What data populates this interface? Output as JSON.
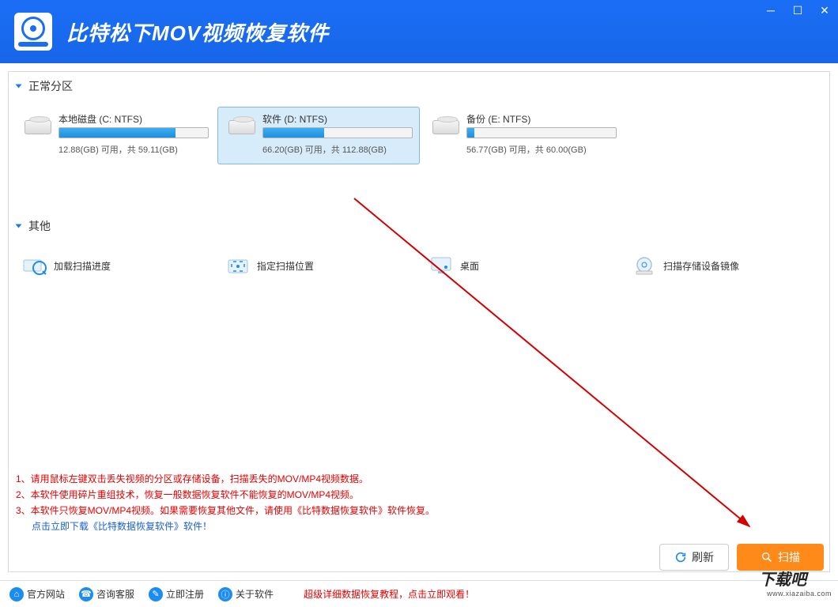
{
  "app_title": "比特松下MOV视频恢复软件",
  "sections": {
    "partitions_title": "正常分区",
    "others_title": "其他"
  },
  "partitions": [
    {
      "name": "本地磁盘 (C: NTFS)",
      "detail": "12.88(GB) 可用，共 59.11(GB)",
      "fill_pct": 78,
      "selected": false
    },
    {
      "name": "软件 (D: NTFS)",
      "detail": "66.20(GB) 可用，共 112.88(GB)",
      "fill_pct": 41,
      "selected": true
    },
    {
      "name": "备份 (E: NTFS)",
      "detail": "56.77(GB) 可用，共 60.00(GB)",
      "fill_pct": 5,
      "selected": false
    }
  ],
  "others": [
    {
      "label": "加载扫描进度",
      "icon": "load-progress-icon"
    },
    {
      "label": "指定扫描位置",
      "icon": "set-location-icon"
    },
    {
      "label": "桌面",
      "icon": "desktop-icon"
    },
    {
      "label": "扫描存储设备镜像",
      "icon": "scan-image-icon"
    }
  ],
  "tips": {
    "line1": "1、请用鼠标左键双击丢失视频的分区或存储设备，扫描丢失的MOV/MP4视频数据。",
    "line2": "2、本软件使用碎片重组技术，恢复一般数据恢复软件不能恢复的MOV/MP4视频。",
    "line3": "3、本软件只恢复MOV/MP4视频。如果需要恢复其他文件，请使用《比特数据恢复软件》软件恢复。",
    "line4": "点击立即下载《比特数据恢复软件》软件！"
  },
  "buttons": {
    "refresh": "刷新",
    "scan": "扫描"
  },
  "bottom_bar": {
    "items": [
      {
        "label": "官方网站"
      },
      {
        "label": "咨询客服"
      },
      {
        "label": "立即注册"
      },
      {
        "label": "关于软件"
      }
    ],
    "tutorial": "超级详细数据恢复教程，点击立即观看！"
  },
  "watermark": {
    "text": "下载吧",
    "url": "www.xiazaiba.com"
  }
}
